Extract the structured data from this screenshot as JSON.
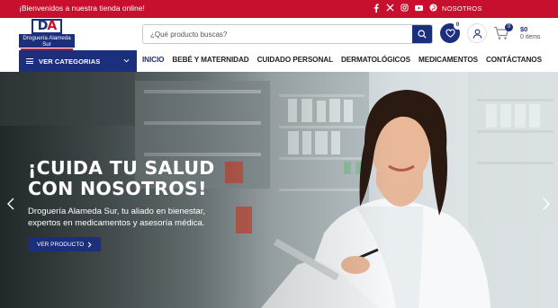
{
  "topbar": {
    "welcome": "¡Bienvenidos a nuestra tienda online!",
    "social_icons": [
      "facebook-icon",
      "x-icon",
      "instagram-icon",
      "youtube-icon",
      "pinterest-icon"
    ],
    "about_link": "NOSOTROS"
  },
  "logo": {
    "monogram_d": "D",
    "monogram_a": "A",
    "name": "Droguería Alameda Sur"
  },
  "search": {
    "placeholder": "¿Qué producto buscas?",
    "value": ""
  },
  "header": {
    "wishlist_count": "0",
    "cart_count": "0",
    "cart_total": "$0",
    "cart_items": "0 items"
  },
  "nav": {
    "categories_label": "VER CATEGORIAS",
    "items": [
      {
        "label": "INICIO",
        "active": true
      },
      {
        "label": "BEBÉ Y MATERNIDAD"
      },
      {
        "label": "CUIDADO PERSONAL"
      },
      {
        "label": "DERMATOLÓGICOS"
      },
      {
        "label": "MEDICAMENTOS"
      },
      {
        "label": "CONTÁCTANOS"
      }
    ]
  },
  "hero": {
    "title_line1": "¡CUIDA TU SALUD",
    "title_line2": "CON NOSOTROS!",
    "subtitle_line1": "Droguería Alameda Sur, tu aliado en bienestar,",
    "subtitle_line2": "expertos en medicamentos y asesoría médica.",
    "button_label": "VER PRODUCTO"
  },
  "colors": {
    "brand_red": "#c8102e",
    "brand_navy": "#1b2f7c"
  }
}
